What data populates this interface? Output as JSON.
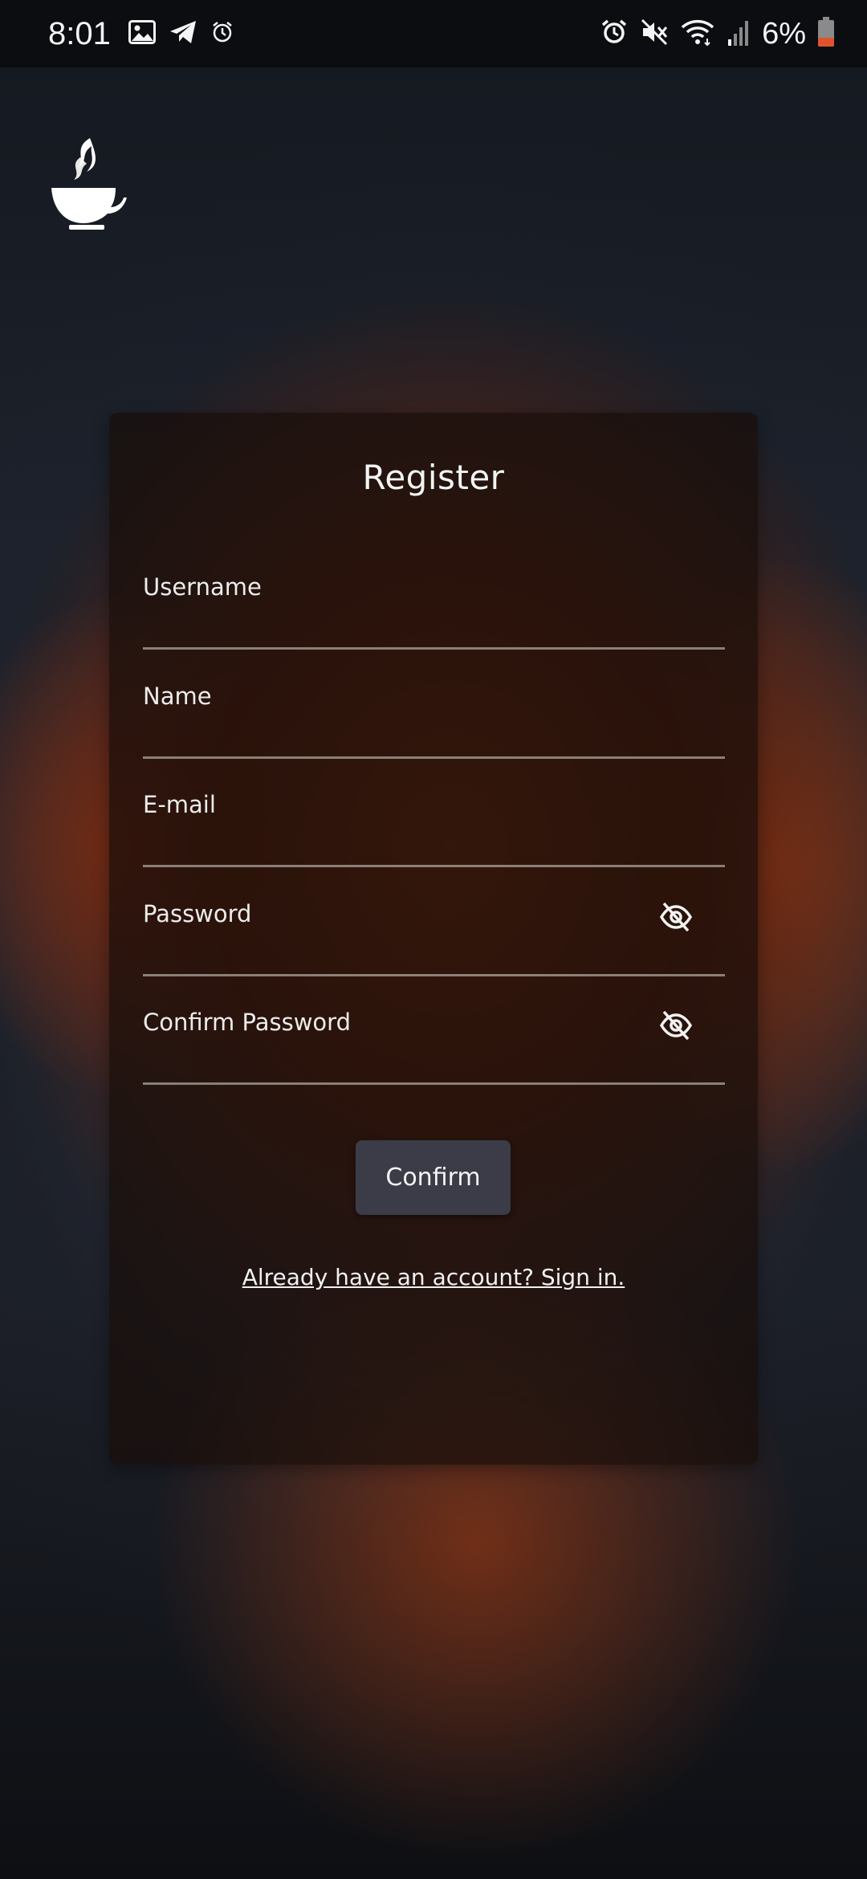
{
  "status_bar": {
    "time": "8:01",
    "battery_percent": "6%",
    "left_icons": [
      "gallery-icon",
      "telegram-icon",
      "alarm-clock-icon"
    ],
    "right_icons": [
      "alarm-icon",
      "mute-icon",
      "wifi-icon",
      "signal-icon",
      "battery-low-icon"
    ]
  },
  "app": {
    "logo": "coffee-cup-logo"
  },
  "register": {
    "title": "Register",
    "fields": [
      {
        "label": "Username"
      },
      {
        "label": "Name"
      },
      {
        "label": "E-mail"
      },
      {
        "label": "Password",
        "icon": "eye-off-icon"
      },
      {
        "label": "Confirm Password",
        "icon": "eye-off-icon"
      }
    ],
    "confirm_label": "Confirm",
    "signin_link": "Already have an account? Sign in."
  },
  "colors": {
    "card_background": "#1e110c",
    "button_background": "#3b3c48",
    "underline": "#dcd7d2",
    "battery_low": "#e0532f"
  }
}
